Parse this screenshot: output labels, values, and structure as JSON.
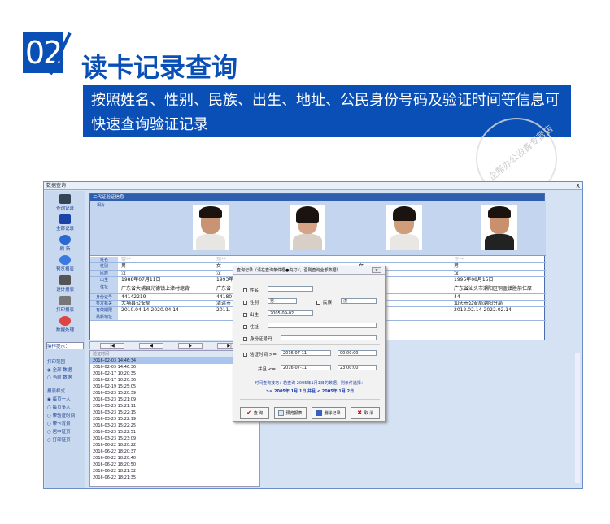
{
  "header": {
    "num": "02",
    "title": "读卡记录查询",
    "desc": "按照姓名、性别、民族、出生、地址、公民身份号码及验证时间等信息可快速查询验证记录"
  },
  "window": {
    "title": "数据查询",
    "close": "X"
  },
  "sidebar": {
    "items": [
      "查询记录",
      "全部记录",
      "刷 新",
      "预览报表",
      "设计报表",
      "打印报表",
      "数据处理"
    ],
    "op_label": "操作提示：",
    "range_label": "打印范围",
    "range_opts": [
      "全部 数据",
      "当前 数据"
    ],
    "style_label": "报表样式",
    "style_opts": [
      "每页一人",
      "每页多人",
      "带验证时间",
      "带卡背景",
      "居中证页",
      "打印证页"
    ]
  },
  "card": {
    "header": "二代证验证信息",
    "photo_label": "相片",
    "row_labels": [
      "姓名",
      "性别",
      "民族",
      "出生",
      "住址",
      "身份证号",
      "签发机关",
      "有效期限",
      "最新地址"
    ],
    "records": [
      {
        "name": "黎**",
        "sex": "男",
        "nation": "汉",
        "birth": "1988年07月11日",
        "addr": "广东省大埔县光德镇上漳村塘背",
        "id": "44142219",
        "org": "大埔县公安局",
        "valid": "2010.04.14-2020.04.14"
      },
      {
        "name": "邓**",
        "sex": "女",
        "nation": "汉",
        "birth": "1993年",
        "addr": "广东省",
        "id": "44180",
        "org": "清远市",
        "valid": "2011."
      },
      {
        "name": "",
        "sex": "女",
        "nation": "",
        "birth": "",
        "addr": "",
        "id": "",
        "org": "",
        "valid": ""
      },
      {
        "name": "许**",
        "sex": "男",
        "nation": "汉",
        "birth": "1995年08月15日",
        "addr": "广东省汕头市潮阳区铜盂镇胜前仁厚",
        "id": "44",
        "org": "汕头市公安局潮阳分局",
        "valid": "2012.02.14-2022.02.14"
      }
    ]
  },
  "pager": [
    "|◀",
    "◀",
    "▶",
    "▶|"
  ],
  "list": {
    "header": "验证时间",
    "rows": [
      "2016-02-03 14:46:34",
      "2016-02-03 14:46:36",
      "2016-02-17 10:20:35",
      "2016-02-17 10:20:36",
      "2016-02-19 15:25:05",
      "2016-03-23 15:20:39",
      "2016-03-23 15:21:09",
      "2016-03-23 15:21:11",
      "2016-03-23 15:22:15",
      "2016-03-23 15:22:19",
      "2016-03-23 15:22:25",
      "2016-03-23 15:22:51",
      "2016-03-23 15:23:09",
      "2016-06-22 18:20:22",
      "2016-06-22 18:20:37",
      "2016-06-22 18:20:40",
      "2016-06-22 18:20:50",
      "2016-06-22 18:21:32",
      "2016-06-22 18:21:35"
    ]
  },
  "dialog": {
    "title": "查询记录（请在查询条件框●内打√，否则查询全部数据）",
    "close": "×",
    "name_l": "姓名",
    "sex_l": "性别",
    "sex_v": "男",
    "nation_l": "民族",
    "nation_v": "汉",
    "birth_l": "出生",
    "birth_v": "2005-09-02",
    "addr_l": "住址",
    "id_l": "身份证号码",
    "time_l": "验证时间 >=",
    "date1": "2016-07-11",
    "time1": "00:00:00",
    "and_l": "并且 <=",
    "date2": "2016-07-11",
    "time2": "23:00:00",
    "tip1": "时间查询技巧：若查询 2005年1月1日的数据，则条件选择：",
    "tip2": ">= 2005年 1月 1日 并且 < 2005年 1月 2日",
    "buttons": [
      "查 询",
      "预览报表",
      "删除记录",
      "取 消"
    ]
  },
  "stamp": "企帮办公设备专营店"
}
